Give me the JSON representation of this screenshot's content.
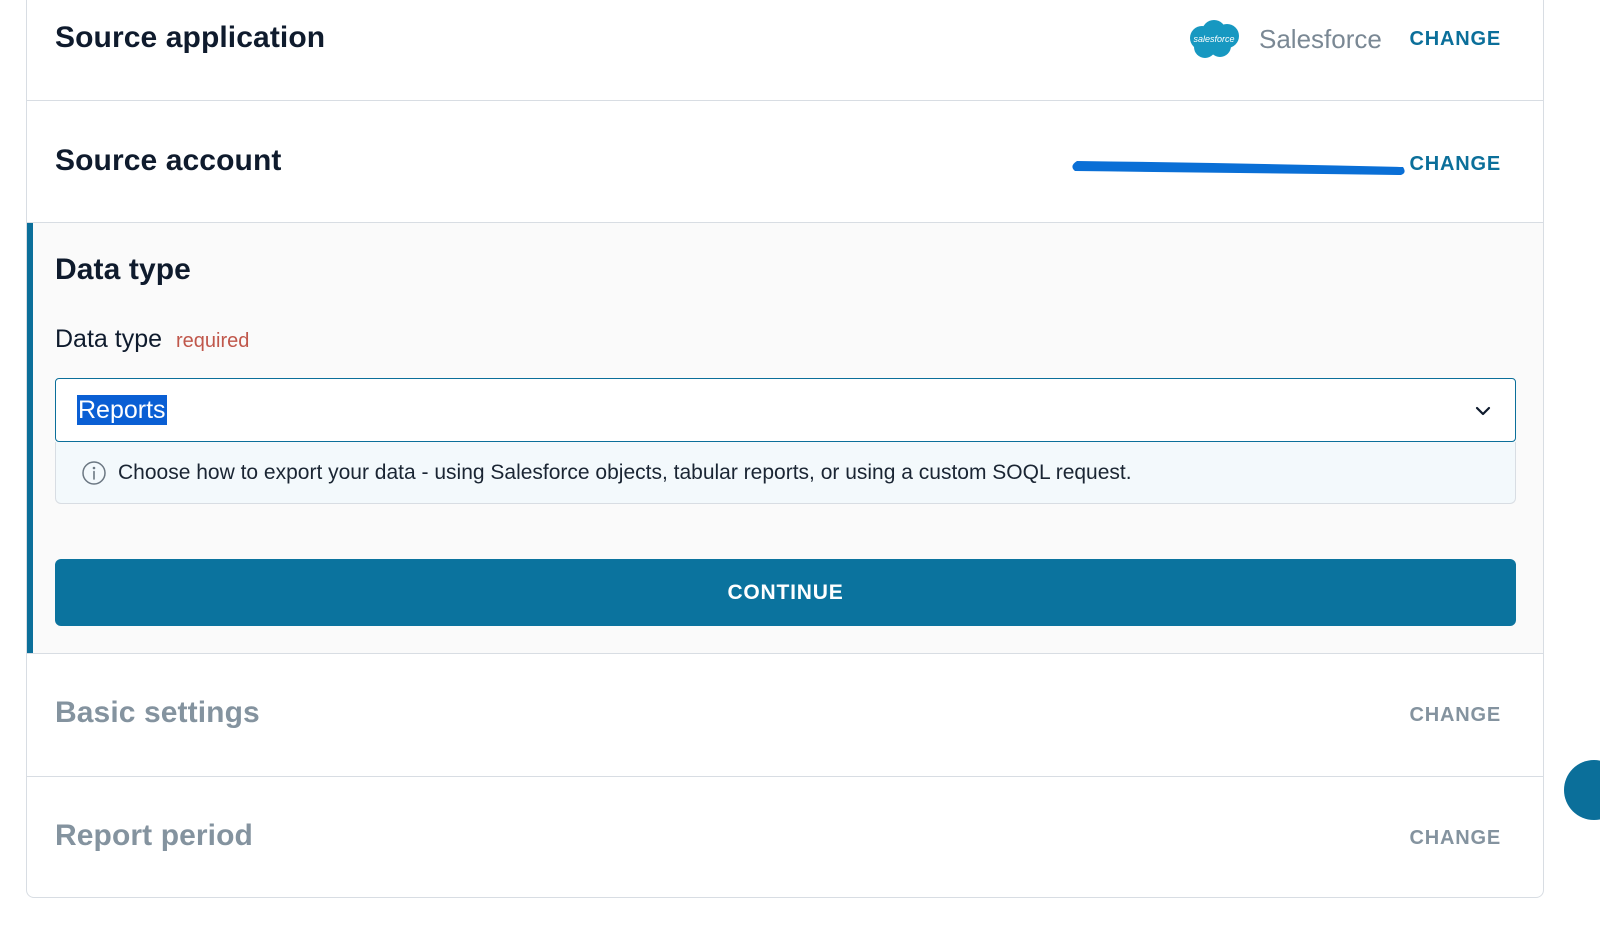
{
  "source_application": {
    "title": "Source application",
    "app_name": "Salesforce",
    "logo_text": "salesforce",
    "change_label": "CHANGE"
  },
  "source_account": {
    "title": "Source account",
    "change_label": "CHANGE"
  },
  "data_type": {
    "title": "Data type",
    "field_label": "Data type",
    "required_label": "required",
    "selected_value": "Reports",
    "hint": "Choose how to export your data - using Salesforce objects, tabular reports, or using a custom SOQL request.",
    "continue_label": "CONTINUE"
  },
  "basic_settings": {
    "title": "Basic settings",
    "change_label": "CHANGE"
  },
  "report_period": {
    "title": "Report period",
    "change_label": "CHANGE"
  },
  "colors": {
    "accent": "#0b6f9a",
    "button": "#0b739e",
    "required": "#c0574b",
    "muted": "#84939f",
    "selection": "#0a5fd4",
    "salesforce": "#1798c1"
  },
  "icons": [
    "salesforce-logo-icon",
    "chevron-down-icon",
    "info-icon"
  ]
}
